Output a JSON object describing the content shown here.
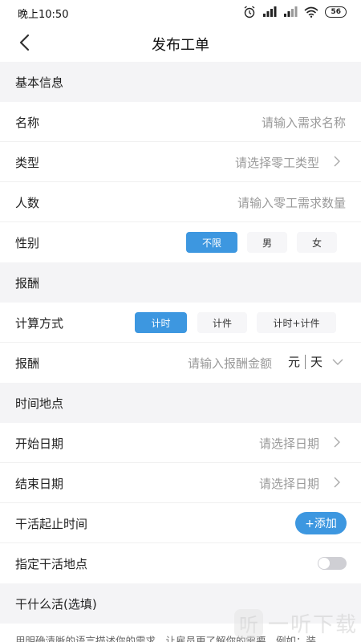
{
  "status_bar": {
    "time": "晚上10:50",
    "battery": "56"
  },
  "nav": {
    "title": "发布工单"
  },
  "sections": {
    "basic": "基本信息",
    "pay": "报酬",
    "time_place": "时间地点",
    "what": "干什么活(选填)"
  },
  "fields": {
    "name": {
      "label": "名称",
      "placeholder": "请输入需求名称"
    },
    "type": {
      "label": "类型",
      "placeholder": "请选择零工类型"
    },
    "count": {
      "label": "人数",
      "placeholder": "请输入零工需求数量"
    },
    "gender": {
      "label": "性别",
      "options": [
        "不限",
        "男",
        "女"
      ],
      "selected": "不限"
    },
    "calc": {
      "label": "计算方式",
      "options": [
        "计时",
        "计件",
        "计时+计件"
      ],
      "selected": "计时"
    },
    "pay": {
      "label": "报酬",
      "placeholder": "请输入报酬金额",
      "unit_currency": "元",
      "unit_period": "天"
    },
    "start_date": {
      "label": "开始日期",
      "placeholder": "请选择日期"
    },
    "end_date": {
      "label": "结束日期",
      "placeholder": "请选择日期"
    },
    "work_time": {
      "label": "干活起止时间",
      "button": "+添加"
    },
    "location": {
      "label": "指定干活地点",
      "enabled": false
    }
  },
  "description": {
    "placeholder": "用明确清晰的语言描述你的需求，让雇员更了解你的需要。例如：装"
  },
  "watermark": {
    "text": "一听下载",
    "logo_char": "听"
  },
  "colors": {
    "accent": "#3d97e0",
    "section_bg": "#f4f4f6",
    "placeholder": "#9a9a9a"
  }
}
